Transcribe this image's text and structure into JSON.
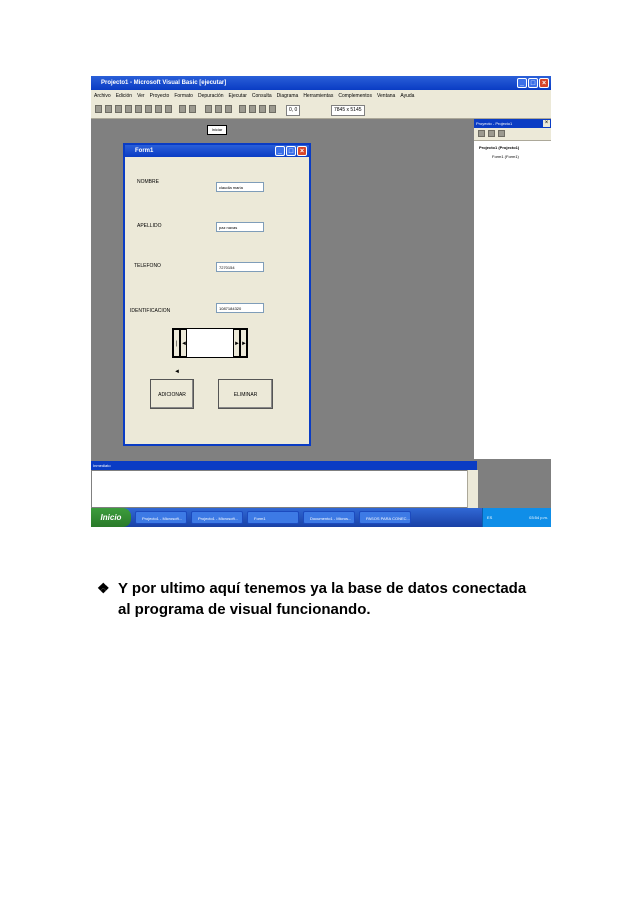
{
  "screenshot": {
    "window_title": "Projecto1 - Microsoft Visual Basic [ejecutar]",
    "menu": [
      "Archivo",
      "Edición",
      "Ver",
      "Proyecto",
      "Formato",
      "Depuración",
      "Ejecutar",
      "Consulta",
      "Diagrama",
      "Herramientas",
      "Complementos",
      "Ventana",
      "Ayuda"
    ],
    "coord_pos": "0, 0",
    "coord_size": "7845 x 5145",
    "iniciar_label": "Iniciar",
    "form": {
      "title": "Form1",
      "fields": [
        {
          "label": "NOMBRE",
          "value": "claudia maria"
        },
        {
          "label": "APELLIDO",
          "value": "paz navas"
        },
        {
          "label": "TELEFONO",
          "value": "7270154"
        },
        {
          "label": "IDENTIFICACION",
          "value": "1087184320"
        }
      ],
      "add_button": "ADICIONAR",
      "delete_button": "ELIMINAR"
    },
    "project_panel": {
      "title": "Proyecto - Projecto1",
      "root": "Projecto1 (Projecto1)",
      "child": "Form1 (Form1)"
    },
    "immediate_title": "Inmediato",
    "taskbar": {
      "start": "Inicio",
      "items": [
        "Projecto1 - Microsoft...",
        "Projecto1 - Microsoft...",
        "Form1",
        "Documento1 - Micros...",
        "PASOS PARA CONEC..."
      ],
      "lang": "ES",
      "clock": "03:54 p.m."
    },
    "colors": {
      "title_blue": "#0a3cc4",
      "form_bg": "#ece9d8",
      "desktop_gray": "#808080"
    }
  },
  "caption": {
    "bullet_icon": "diamond-bullet-icon",
    "text": "Y por ultimo aquí tenemos ya la base de datos conectada al programa de visual funcionando."
  }
}
